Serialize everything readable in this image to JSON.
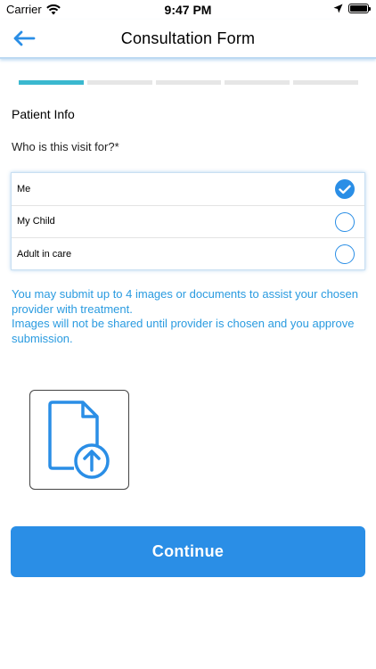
{
  "status_bar": {
    "carrier": "Carrier",
    "time": "9:47 PM"
  },
  "nav": {
    "title": "Consultation Form",
    "back_icon": "arrow-left-icon"
  },
  "progress": {
    "total_steps": 5,
    "current_step": 1
  },
  "form": {
    "section_title": "Patient Info",
    "question": "Who is this visit for?*",
    "options": [
      {
        "label": "Me",
        "selected": true
      },
      {
        "label": "My Child",
        "selected": false
      },
      {
        "label": "Adult in care",
        "selected": false
      }
    ],
    "info_text": "You may submit up to 4 images or documents to assist your chosen provider with treatment.\n Images will not be shared until provider is chosen and you approve submission.",
    "upload_icon": "document-upload-icon"
  },
  "actions": {
    "continue_label": "Continue"
  },
  "colors": {
    "accent": "#2a8ee6",
    "progress_active": "#3bb8cf",
    "info_text": "#2a9be0"
  }
}
